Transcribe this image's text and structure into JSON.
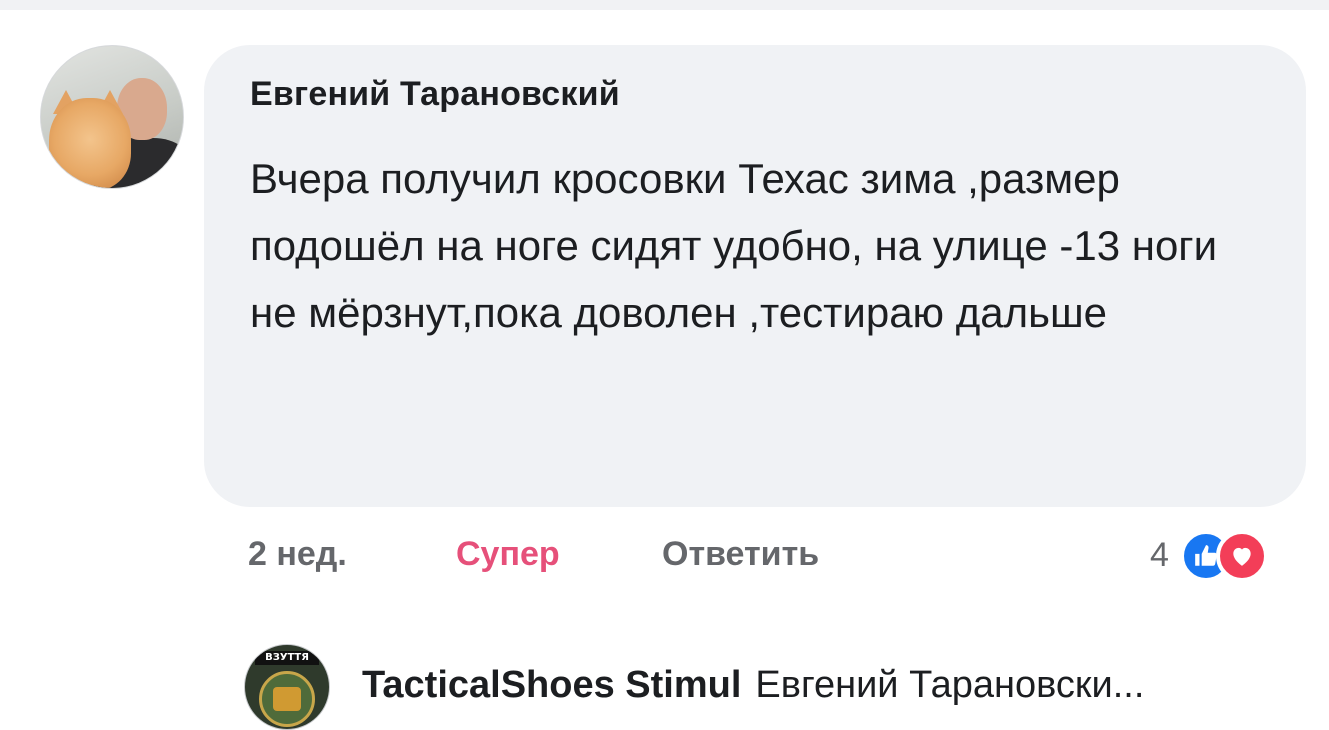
{
  "comment": {
    "author": "Евгений Тарановский",
    "text": "Вчера получил кросовки Техас зима ,размер подошёл на ноге сидят удобно, на улице -13 ноги не мёрзнут,пока доволен ,тестираю дальше",
    "time": "2 нед.",
    "reaction_label": "Супер",
    "reply_label": "Ответить",
    "reaction_count": "4",
    "reaction_icons": [
      "like-icon",
      "love-icon"
    ]
  },
  "reply": {
    "author": "TacticalShoes Stimul",
    "preview": "Евгений Тарановски...",
    "avatar_label": "ВЗУТТЯ"
  },
  "colors": {
    "bubble": "#f0f2f5",
    "text": "#1c1e21",
    "meta": "#65676b",
    "super": "#e6507a",
    "like": "#1877f2",
    "love": "#f33e58"
  }
}
